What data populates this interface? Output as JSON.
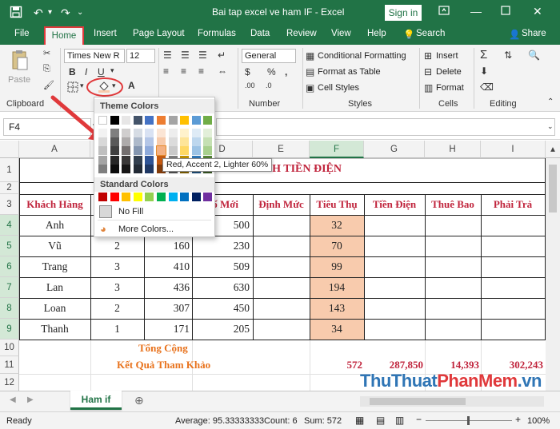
{
  "titlebar": {
    "title": "Bai tap excel ve ham IF  -  Excel",
    "sign_in": "Sign in"
  },
  "tabs": [
    "File",
    "Home",
    "Insert",
    "Page Layout",
    "Formulas",
    "Data",
    "Review",
    "View",
    "Help"
  ],
  "tell_me": "Search",
  "share": "Share",
  "ribbon": {
    "clipboard_label": "Clipboard",
    "paste_label": "Paste",
    "font_name": "Times New R",
    "font_size": "12",
    "number_format": "General",
    "number_label": "Number",
    "conditional_formatting": "Conditional Formatting",
    "format_as_table": "Format as Table",
    "cell_styles": "Cell Styles",
    "styles_label": "Styles",
    "insert": "Insert",
    "delete": "Delete",
    "format": "Format",
    "cells_label": "Cells",
    "editing_label": "Editing"
  },
  "namebox": "F4",
  "columns": [
    "A",
    "B",
    "C",
    "D",
    "E",
    "F",
    "G",
    "H",
    "I"
  ],
  "rows": [
    "1",
    "2",
    "3",
    "4",
    "5",
    "6",
    "7",
    "8",
    "9",
    "10",
    "11",
    "12"
  ],
  "sheet": {
    "title_partial": "NH TIỀN ĐIỆN",
    "headers": {
      "a": "Khách Hàng",
      "d": "Số Mới",
      "e": "Định Mức",
      "f": "Tiêu Thụ",
      "g": "Tiền Điện",
      "h": "Thuê Bao",
      "i": "Phải Trả"
    },
    "data_rows": [
      {
        "name": "Anh",
        "b": "",
        "c": "",
        "d": "500",
        "f": "32"
      },
      {
        "name": "Vũ",
        "b": "2",
        "c": "160",
        "d": "230",
        "f": "70"
      },
      {
        "name": "Trang",
        "b": "3",
        "c": "410",
        "d": "509",
        "f": "99"
      },
      {
        "name": "Lan",
        "b": "3",
        "c": "436",
        "d": "630",
        "f": "194"
      },
      {
        "name": "Loan",
        "b": "2",
        "c": "307",
        "d": "450",
        "f": "143"
      },
      {
        "name": "Thanh",
        "b": "1",
        "c": "171",
        "d": "205",
        "f": "34"
      }
    ],
    "total_label": "Tổng Cộng",
    "ref_label": "Kết Quả Tham Khảo",
    "ref_f": "572",
    "ref_g": "287,850",
    "ref_h": "14,393",
    "ref_i": "302,243"
  },
  "sheet_tab": "Ham if",
  "status": {
    "ready": "Ready",
    "average": "Average: 95.33333333",
    "count": "Count: 6",
    "sum": "Sum: 572",
    "zoom": "100%"
  },
  "color_menu": {
    "theme_title": "Theme Colors",
    "standard_title": "Standard Colors",
    "no_fill": "No Fill",
    "more_colors": "More Colors...",
    "tooltip": "Red, Accent 2, Lighter 60%",
    "theme_top": [
      "#ffffff",
      "#000000",
      "#e7e6e6",
      "#44546a",
      "#4472c4",
      "#ed7d31",
      "#a5a5a5",
      "#ffc000",
      "#5b9bd5",
      "#70ad47"
    ],
    "theme_shades": [
      [
        "#f2f2f2",
        "#7f7f7f",
        "#d0cece",
        "#d6dce4",
        "#d9e2f3",
        "#fbe5d5",
        "#ededed",
        "#fff2cc",
        "#deebf6",
        "#e2efd9"
      ],
      [
        "#d8d8d8",
        "#595959",
        "#aeabab",
        "#adb9ca",
        "#b4c6e7",
        "#f7cbac",
        "#dbdbdb",
        "#fee599",
        "#bdd7ee",
        "#c5e0b3"
      ],
      [
        "#bfbfbf",
        "#3f3f3f",
        "#757070",
        "#8496b0",
        "#8eaadb",
        "#f4b183",
        "#c9c9c9",
        "#ffd965",
        "#9cc3e5",
        "#a8d08d"
      ],
      [
        "#a5a5a5",
        "#262626",
        "#3a3838",
        "#323f4f",
        "#2f5496",
        "#c55a11",
        "#7b7b7b",
        "#bf9000",
        "#2e75b5",
        "#538135"
      ],
      [
        "#7f7f7f",
        "#0c0c0c",
        "#171616",
        "#222a35",
        "#1f3864",
        "#833c0b",
        "#525252",
        "#7f6000",
        "#1f4e79",
        "#375623"
      ]
    ],
    "standard": [
      "#c00000",
      "#ff0000",
      "#ffc000",
      "#ffff00",
      "#92d050",
      "#00b050",
      "#00b0f0",
      "#0070c0",
      "#002060",
      "#7030a0"
    ]
  },
  "watermark": {
    "part1": "ThuThuat",
    "part2": "PhanMem",
    "part3": ".vn"
  },
  "colors": {
    "excel_green": "#217346",
    "header_red": "#c0243c",
    "orange_text": "#e8721c",
    "highlight_pink": "#f8cbad",
    "annotation_red": "#e0393b"
  }
}
